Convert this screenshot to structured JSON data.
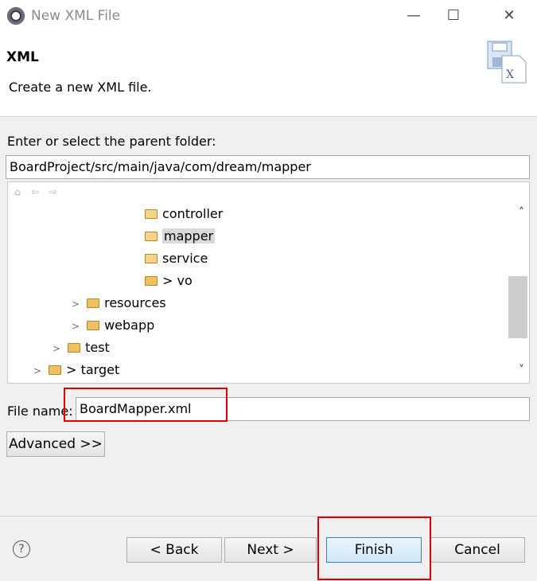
{
  "window": {
    "title": "New XML File",
    "minimize_icon": "minimize-icon",
    "maximize_icon": "maximize-icon",
    "close_icon": "close-icon"
  },
  "header": {
    "title": "XML",
    "description": "Create a new XML file."
  },
  "parent_folder": {
    "label": "Enter or select the parent folder:",
    "value": "BoardProject/src/main/java/com/dream/mapper"
  },
  "tree": {
    "items": [
      {
        "label": "controller",
        "chevron": "",
        "prefix": ""
      },
      {
        "label": "mapper",
        "chevron": "",
        "prefix": "",
        "selected": true
      },
      {
        "label": "service",
        "chevron": "",
        "prefix": ""
      },
      {
        "label": "vo",
        "chevron": "",
        "prefix": "> "
      },
      {
        "label": "resources",
        "chevron": ">",
        "prefix": ""
      },
      {
        "label": "webapp",
        "chevron": ">",
        "prefix": ""
      },
      {
        "label": "test",
        "chevron": ">",
        "prefix": ""
      },
      {
        "label": "target",
        "chevron": ">",
        "prefix": "> "
      }
    ]
  },
  "file_name": {
    "label": "File name:",
    "value": "BoardMapper.xml"
  },
  "advanced_button": "Advanced >>",
  "buttons": {
    "back": "< Back",
    "next": "Next >",
    "finish": "Finish",
    "cancel": "Cancel"
  },
  "help_symbol": "?",
  "colors": {
    "highlight_box": "#e00000",
    "default_button_border": "#3c7fb1"
  }
}
